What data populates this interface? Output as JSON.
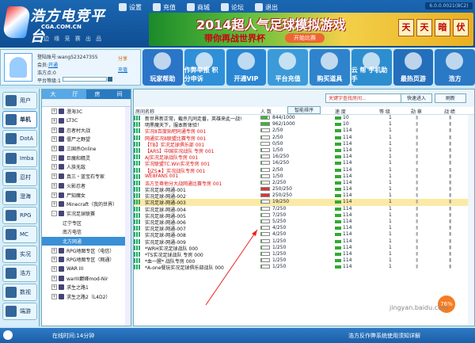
{
  "top": {
    "brand": "浩方电竞平台",
    "brand_url": "CGA.COM.CN",
    "slogan": "边 缘 竞 赛 出 品",
    "version": "6.0.0.0021(BC2)",
    "menu": [
      "设置",
      "充值",
      "商城",
      "论坛",
      "退出"
    ]
  },
  "banner": {
    "headline": "2014超人气足球模拟游戏",
    "sub": "带你再战世界杯",
    "button": "开始比赛",
    "chips": [
      "天",
      "天",
      "暗",
      "伏"
    ]
  },
  "user": {
    "id_label": "登陆账号:",
    "id_value": "wang523247355",
    "vip_label": "会员:",
    "vip_link": "开通",
    "deposit_label": "浩方点:",
    "deposit_value": "0",
    "level_label": "平台等级:1",
    "share": "分享",
    "recharge": "充值"
  },
  "quick": [
    {
      "label": "玩家帮助",
      "color": "#2b75c9"
    },
    {
      "label": "作弊举报 积分申诉",
      "color": "#2f8fd8"
    },
    {
      "label": "开通VIP",
      "color": "#2a86d2"
    },
    {
      "label": "平台充值",
      "color": "#3c9ad9"
    },
    {
      "label": "购买道具",
      "color": "#2f83cd"
    },
    {
      "label": "云 帮 手机助手",
      "color": "#2d8ecf"
    },
    {
      "label": "最热页游",
      "color": "#246fbb"
    },
    {
      "label": "浩方",
      "color": "#2a79c5"
    }
  ],
  "left_tabs": [
    "用户",
    "单机",
    "DotA",
    "Imba",
    "忍村",
    "澄海",
    "RPG",
    "MC",
    "实况",
    "浩方",
    "数视",
    "端游"
  ],
  "tree": {
    "tabs": [
      "大",
      "厅",
      "房",
      "间"
    ],
    "items": [
      "澄海3C",
      "LT3C",
      "忍者村大战",
      "僵尸之野望",
      "三国杀Online",
      "巨魔和精灵",
      "人族无敌",
      "真三・蓝宝石专家",
      "火影忍者",
      "尸知魔女",
      "Minecraft（我的世界）",
      "实况足球联赛",
      "辽宁专区",
      "南方电信",
      "北方网通",
      "RPG地图专区（电信）",
      "RPG地图专区（网通）",
      "WAR III",
      "warIII巅峰mod-Nir",
      "求生之路1",
      "求生之路2（L4D2）"
    ]
  },
  "room": {
    "search_placeholder": "关键字查找房间...",
    "quick_join": "快速进入",
    "refresh": "刷新",
    "columns": {
      "name": "房间名称",
      "people": "人 数",
      "sort": "智能排序",
      "speed": "速 度",
      "level": "等 级",
      "rank": "勋 章",
      "war": "战 绩"
    },
    "rows": [
      {
        "name": "新世界新正常，截杀凡同走番，英雄来此一战!",
        "count": "844/1000",
        "speed": "10",
        "lvl": "1",
        "fill": 0.84,
        "red": false
      },
      {
        "name": "明黑魔天下，服本新体验！",
        "count": "962/1000",
        "speed": "10",
        "lvl": "1",
        "fill": 0.96,
        "red": false
      },
      {
        "name": "实况8百度贴吧同通专房 001",
        "count": "2/50",
        "speed": "114",
        "lvl": "1",
        "fill": 0.04,
        "red": false
      },
      {
        "name": "网通实况8联盟比赛专房 001",
        "count": "2/50",
        "speed": "114",
        "lvl": "1",
        "fill": 0.04,
        "red": false
      },
      {
        "name": "【TB】实况足球俱乐部 001",
        "count": "0/50",
        "speed": "114",
        "lvl": "1",
        "fill": 0,
        "red": false
      },
      {
        "name": "【ARS】中国实况战队 专房 001",
        "count": "1/50",
        "speed": "114",
        "lvl": "1",
        "fill": 0.02,
        "red": false
      },
      {
        "name": "AJ实况足球战队专房 001",
        "count": "16/250",
        "speed": "114",
        "lvl": "1",
        "fill": 0.06,
        "red": false
      },
      {
        "name": "实况联盟TC.Win实况专房 001",
        "count": "16/250",
        "speed": "114",
        "lvl": "1",
        "fill": 0.06,
        "red": false
      },
      {
        "name": "【JZS★】实况战队专房 001",
        "count": "2/50",
        "speed": "114",
        "lvl": "1",
        "fill": 0.04,
        "red": false
      },
      {
        "name": "WE8FANS 001",
        "count": "1/50",
        "speed": "114",
        "lvl": "1",
        "fill": 0.02,
        "red": false
      },
      {
        "name": "浩方至尊他分大战网通比赛专房 001",
        "count": "2/250",
        "speed": "114",
        "lvl": "1",
        "fill": 0.01,
        "red": false
      },
      {
        "name": "实况足球-网通-001",
        "count": "250/250",
        "speed": "114",
        "lvl": "1",
        "fill": 1,
        "red": true
      },
      {
        "name": "实况足球-网通-002",
        "count": "250/250",
        "speed": "114",
        "lvl": "1",
        "fill": 1,
        "red": true
      },
      {
        "name": "实况足球-网通-003",
        "count": "19/250",
        "speed": "114",
        "lvl": "1",
        "fill": 0.08,
        "red": false
      },
      {
        "name": "实况足球-网通-004",
        "count": "7/250",
        "speed": "114",
        "lvl": "1",
        "fill": 0.03,
        "red": false
      },
      {
        "name": "实况足球-网通-005",
        "count": "7/250",
        "speed": "114",
        "lvl": "1",
        "fill": 0.03,
        "red": false
      },
      {
        "name": "实况足球-网通-006",
        "count": "5/250",
        "speed": "114",
        "lvl": "1",
        "fill": 0.02,
        "red": false
      },
      {
        "name": "实况足球-网通-007",
        "count": "4/250",
        "speed": "114",
        "lvl": "1",
        "fill": 0.02,
        "red": false
      },
      {
        "name": "实况足球-网通-008",
        "count": "4/250",
        "speed": "114",
        "lvl": "1",
        "fill": 0.02,
        "red": false
      },
      {
        "name": "实况足球-网通-009",
        "count": "1/250",
        "speed": "114",
        "lvl": "1",
        "fill": 0.01,
        "red": false
      },
      {
        "name": "*WRH实况足球战队 000",
        "count": "1/250",
        "speed": "114",
        "lvl": "1",
        "fill": 0.01,
        "red": false
      },
      {
        "name": "*TS实况足球战队 专房 000",
        "count": "1/250",
        "speed": "114",
        "lvl": "1",
        "fill": 0.01,
        "red": false
      },
      {
        "name": "*血一腥* 战队专房 000",
        "count": "1/250",
        "speed": "114",
        "lvl": "1",
        "fill": 0.01,
        "red": false
      },
      {
        "name": "*A-one餐玩实况足球俱乐部战队 000",
        "count": "1/250",
        "speed": "114",
        "lvl": "1",
        "fill": 0.01,
        "red": false
      }
    ]
  },
  "bottom": {
    "time": "在线时间:14分钟",
    "system": "浩方反作弊系统使用须知详解",
    "progress": "76%",
    "watermark": "jingyan.baidu.com"
  }
}
